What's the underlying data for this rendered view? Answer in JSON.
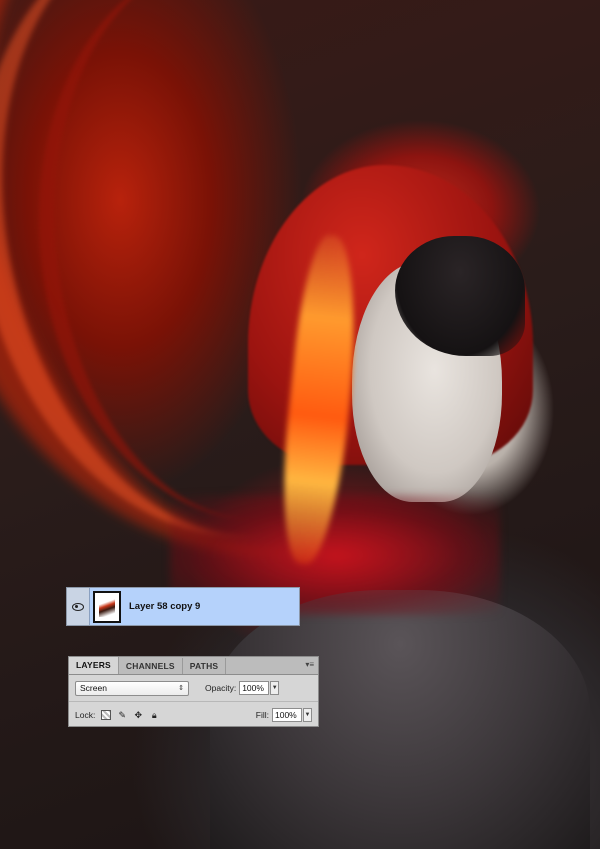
{
  "layers_row": {
    "name": "Layer 58 copy 9",
    "visibility_icon": "eye-icon",
    "thumbnail": "layer-thumbnail"
  },
  "panel": {
    "tabs": [
      {
        "label": "LAYERS",
        "active": true
      },
      {
        "label": "CHANNELS",
        "active": false
      },
      {
        "label": "PATHS",
        "active": false
      }
    ],
    "menu_icon": "panel-menu-icon",
    "blend_mode": "Screen",
    "opacity_label": "Opacity:",
    "opacity_value": "100%",
    "lock_label": "Lock:",
    "lock_icons": [
      "lock-transparent-icon",
      "lock-image-icon",
      "lock-position-icon",
      "lock-all-icon"
    ],
    "fill_label": "Fill:",
    "fill_value": "100%"
  },
  "colors": {
    "selected_layer": "#b5d2fb",
    "panel_bg": "#d6d6d6"
  }
}
